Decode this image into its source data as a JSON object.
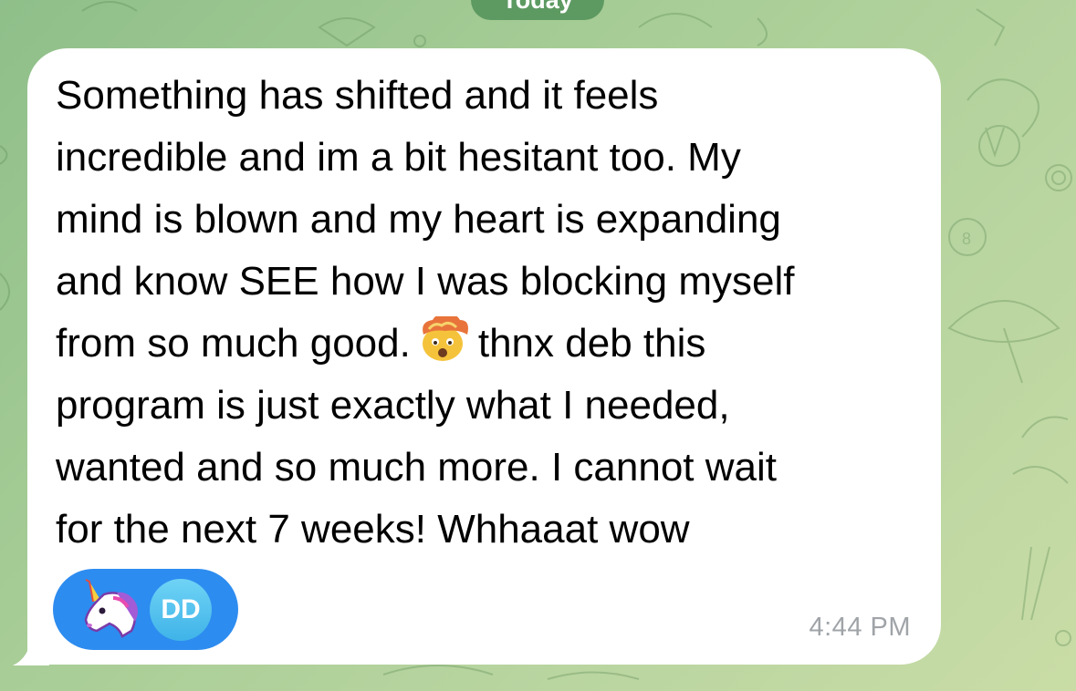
{
  "date_separator": "Today",
  "message": {
    "text_before_emoji": "Something has shifted and it feels\nincredible and im a bit hesitant too. My\nmind is blown and my heart is expanding\nand know SEE how I was blocking myself\nfrom so much good.",
    "emoji": "exploding-head-emoji",
    "text_after_emoji": "thnx deb this\nprogram is just exactly what I needed,\nwanted and so much more. I cannot wait\nfor the next 7 weeks! Whhaaat wow",
    "time": "4:44 PM"
  },
  "reaction": {
    "emoji": "unicorn-emoji",
    "user_initials": "DD",
    "pill_color": "#2d8cf0",
    "avatar_color": "#4cc0ee"
  },
  "colors": {
    "bubble": "#ffffff",
    "date_pill": "#5d9a62",
    "timestamp": "#a0a4a8"
  }
}
